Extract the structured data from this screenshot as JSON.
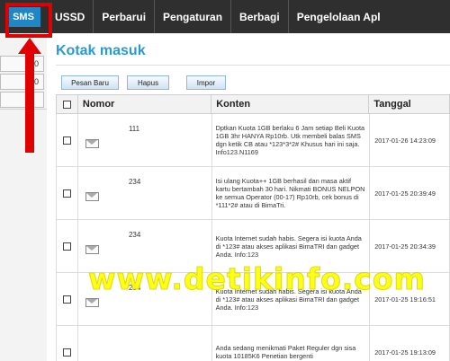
{
  "nav": {
    "sms": "SMS",
    "items": [
      "USSD",
      "Perbarui",
      "Pengaturan",
      "Berbagi",
      "Pengelolaan Apl"
    ]
  },
  "sidebar": {
    "buttons": [
      "0",
      "0"
    ]
  },
  "page": {
    "title": "Kotak masuk"
  },
  "toolbar": {
    "new_label": "Pesan Baru",
    "delete_label": "Hapus",
    "import_label": "Impor"
  },
  "table": {
    "headers": {
      "number": "Nomor",
      "content": "Konten",
      "date": "Tanggal"
    },
    "rows": [
      {
        "sender": "111",
        "content": "Dptkan Kuota 1GB berlaku 6 Jam setiap Beli Kuota 1GB 3hr HANYA Rp10rb. Utk membeli balas SMS dgn ketik CB atau *123*3*2# Khusus hari ini saja. Info123.N1169",
        "date": "2017-01-26 14:23:09"
      },
      {
        "sender": "234",
        "content": "Isi ulang Kuota++ 1GB berhasil dan masa aktif kartu bertambah 30 hari. Nikmati BONUS NELPON ke semua Operator (00-17) Rp10rb, cek bonus di *111*2# atau di BimaTri.",
        "date": "2017-01-25 20:39:49"
      },
      {
        "sender": "234",
        "content": "Kuota Internet sudah habis. Segera isi kuota Anda di *123# atau akses aplikasi BimaTRI dan gadget Anda. Info:123",
        "date": "2017-01-25 20:34:39"
      },
      {
        "sender": "234",
        "content": "Kuota Internet sudah habis. Segera isi kuota Anda di *123# atau akses aplikasi BimaTRI dan gadget Anda. Info:123",
        "date": "2017-01-25 19:16:51"
      },
      {
        "sender": "",
        "content": "Anda sedang menikmati Paket Reguler dgn sisa kuota 10185K6 Penetian bergenti",
        "date": "2017-01-25 19:13:09"
      }
    ]
  },
  "watermark": "www.detikinfo.com",
  "colors": {
    "nav_bg": "#2f2f2f",
    "accent": "#1f87c6",
    "title": "#2a9ad1",
    "highlight": "#e00000",
    "watermark": "#ffff00"
  }
}
